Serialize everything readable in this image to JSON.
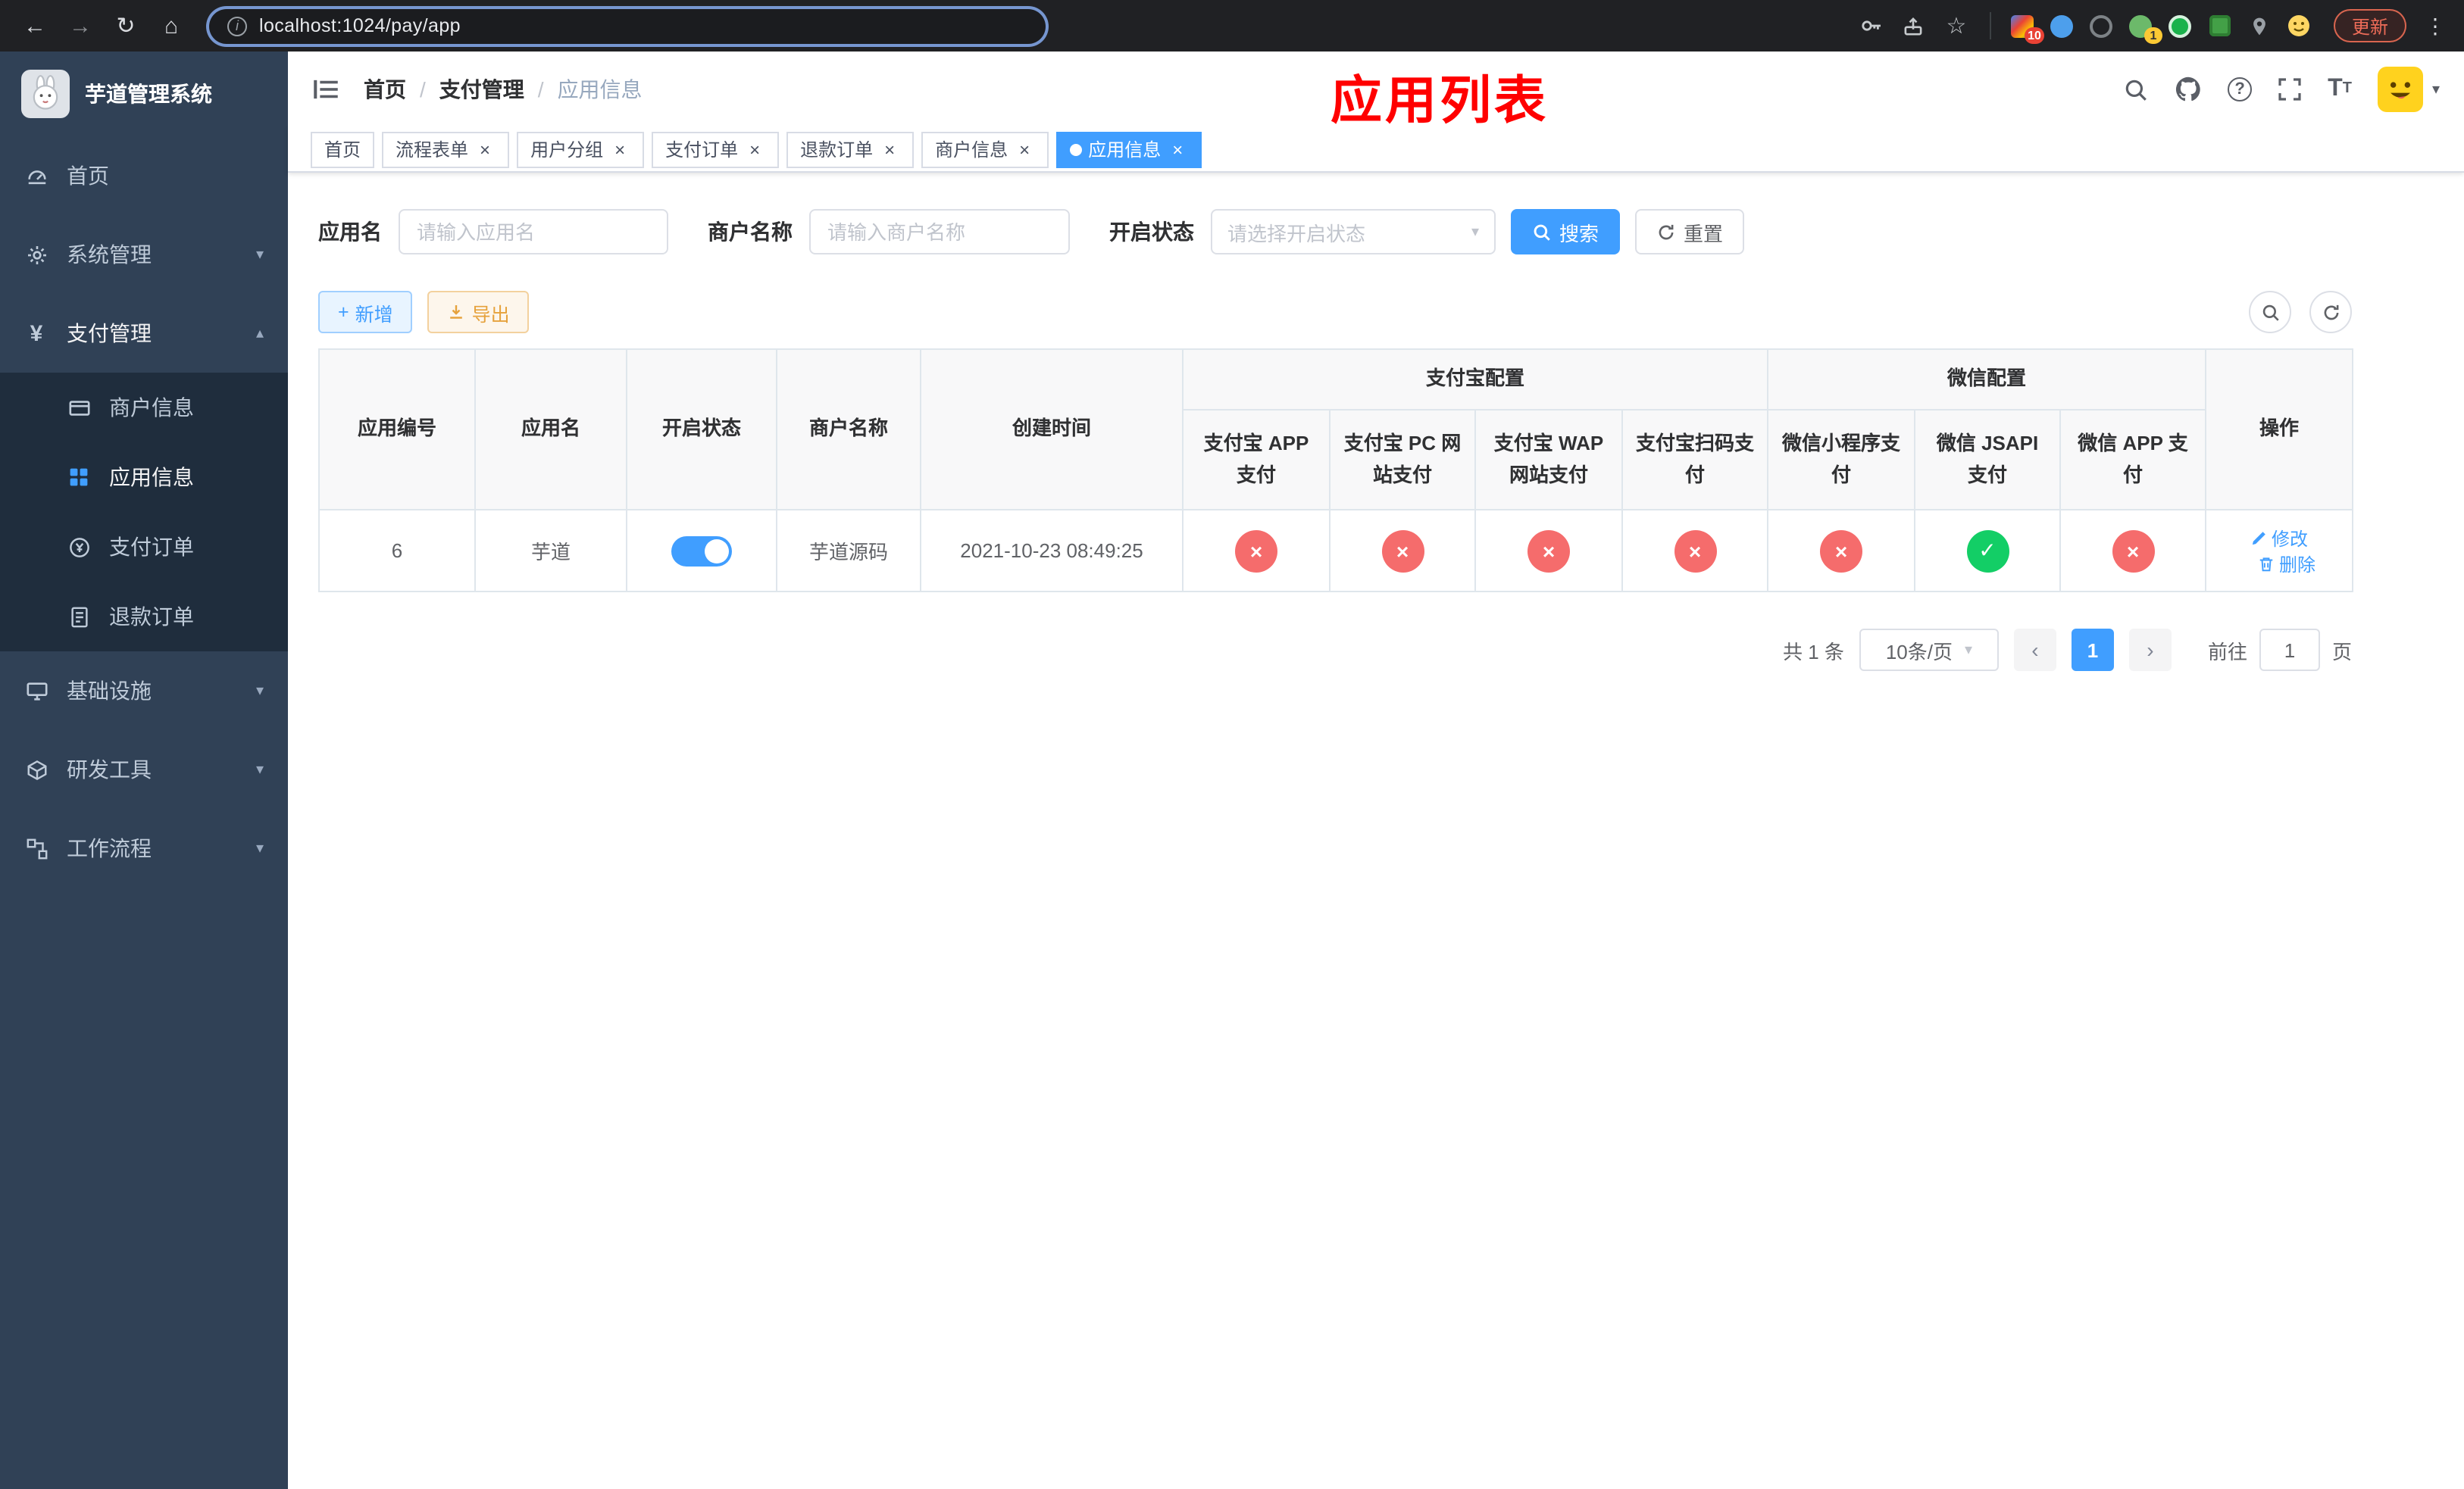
{
  "colors": {
    "accent": "#409eff",
    "danger": "#f56c6c",
    "success": "#13ce66",
    "annotation_red": "#ff0000",
    "sidebar_bg": "#304156",
    "submenu_bg": "#1f2d3d"
  },
  "icons": {
    "back": "←",
    "forward": "→",
    "reload": "↻",
    "home": "⌂",
    "star": "☆",
    "kebab": "⋮",
    "info": "i",
    "close": "×",
    "dot": "●",
    "chevron_down": "▾",
    "chevron_up": "▴",
    "caret": "▾",
    "check": "✓",
    "cross": "×",
    "prev": "‹",
    "next": "›",
    "plus": "+",
    "question": "?",
    "letter_large": "T",
    "letter_small": "T",
    "yen": "¥"
  },
  "browser": {
    "url": "localhost:1024/pay/app",
    "update_label": "更新",
    "extensions_badge": "10",
    "profile_badge": "1"
  },
  "sidebar": {
    "logo_title": "芋道管理系统",
    "items": [
      {
        "label": "首页"
      },
      {
        "label": "系统管理"
      },
      {
        "label": "支付管理",
        "children": [
          {
            "label": "商户信息"
          },
          {
            "label": "应用信息"
          },
          {
            "label": "支付订单"
          },
          {
            "label": "退款订单"
          }
        ]
      },
      {
        "label": "基础设施"
      },
      {
        "label": "研发工具"
      },
      {
        "label": "工作流程"
      }
    ]
  },
  "navbar": {
    "breadcrumb": [
      "首页",
      "支付管理",
      "应用信息"
    ],
    "separator": "/"
  },
  "annotation": {
    "text": "应用列表"
  },
  "tabs": {
    "items": [
      {
        "label": "首页"
      },
      {
        "label": "流程表单"
      },
      {
        "label": "用户分组"
      },
      {
        "label": "支付订单"
      },
      {
        "label": "退款订单"
      },
      {
        "label": "商户信息"
      },
      {
        "label": "应用信息"
      }
    ]
  },
  "filters": {
    "app_name_label": "应用名",
    "app_name_placeholder": "请输入应用名",
    "merchant_label": "商户名称",
    "merchant_placeholder": "请输入商户名称",
    "status_label": "开启状态",
    "status_placeholder": "请选择开启状态",
    "search_button": "搜索",
    "reset_button": "重置"
  },
  "toolbar": {
    "add_button": "新增",
    "export_button": "导出"
  },
  "table": {
    "group_headers": {
      "alipay": "支付宝配置",
      "wechat": "微信配置"
    },
    "columns": [
      "应用编号",
      "应用名",
      "开启状态",
      "商户名称",
      "创建时间",
      "支付宝 APP 支付",
      "支付宝 PC 网站支付",
      "支付宝 WAP 网站支付",
      "支付宝扫码支付",
      "微信小程序支付",
      "微信 JSAPI 支付",
      "微信 APP 支付",
      "操作"
    ],
    "row": {
      "id": "6",
      "name": "芋道",
      "enabled": true,
      "merchant": "芋道源码",
      "created": "2021-10-23 08:49:25",
      "pay_status": [
        "fail",
        "fail",
        "fail",
        "fail",
        "fail",
        "success",
        "fail"
      ],
      "actions": [
        "修改",
        "删除"
      ]
    }
  },
  "pagination": {
    "total": "共 1 条",
    "page_size": "10条/页",
    "current_page": "1",
    "goto_label": "前往",
    "goto_value": "1",
    "page_unit": "页"
  }
}
